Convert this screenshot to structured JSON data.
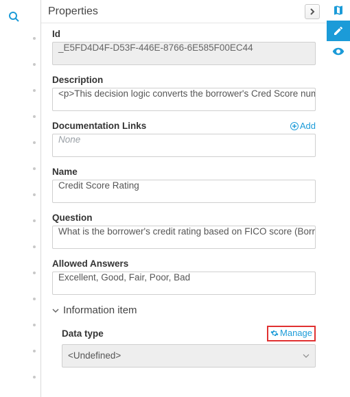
{
  "panel": {
    "title": "Properties"
  },
  "fields": {
    "id": {
      "label": "Id",
      "value": "_E5FD4D4F-D53F-446E-8766-6E585F00EC44"
    },
    "description": {
      "label": "Description",
      "value": "<p>This decision logic converts the borrower's Cred Score numeric"
    },
    "doclinks": {
      "label": "Documentation Links",
      "placeholder": "None",
      "add_label": "Add"
    },
    "name": {
      "label": "Name",
      "value": "Credit Score Rating"
    },
    "question": {
      "label": "Question",
      "value": "What is the borrower's credit rating based on FICO score (Borrwer."
    },
    "answers": {
      "label": "Allowed Answers",
      "value": "Excellent, Good, Fair, Poor, Bad"
    }
  },
  "section": {
    "title": "Information item",
    "datatype": {
      "label": "Data type",
      "manage_label": "Manage",
      "value": "<Undefined>"
    }
  },
  "colors": {
    "accent": "#1b9bd8",
    "highlight": "#e03030"
  }
}
